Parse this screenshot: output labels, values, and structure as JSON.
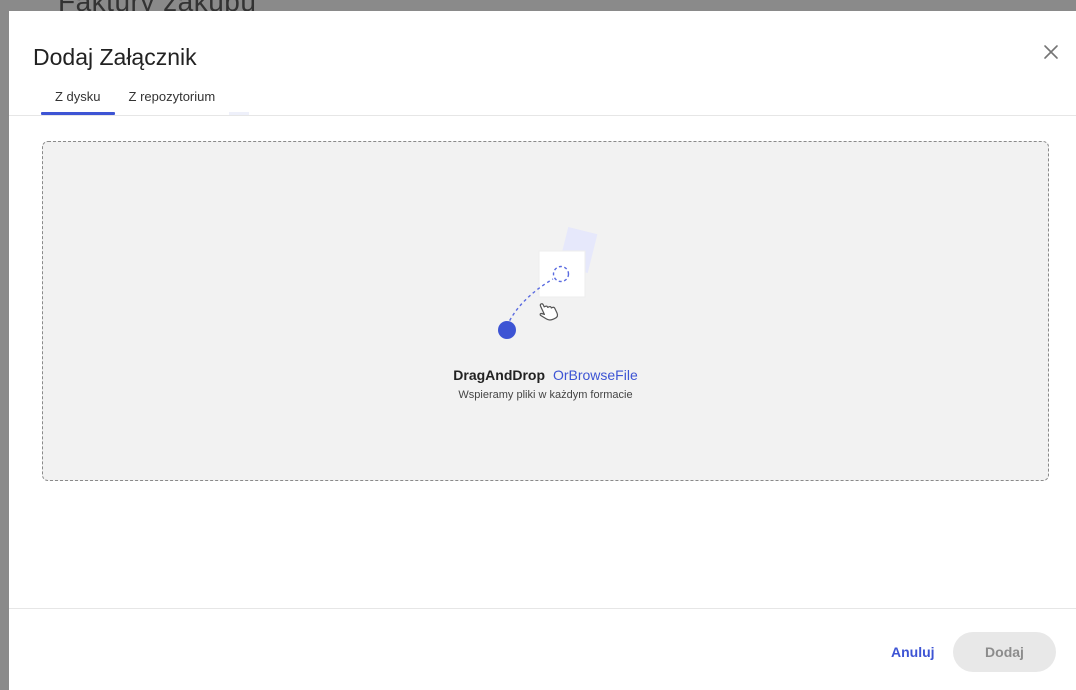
{
  "background": {
    "peek_title": "Faktury zakupu",
    "peek_right": ""
  },
  "dialog": {
    "title": "Dodaj Załącznik",
    "close_icon": "close-icon",
    "tabs": [
      {
        "label": "Z dysku",
        "active": true
      },
      {
        "label": "Z repozytorium",
        "active": false
      }
    ],
    "dropzone": {
      "main_text": "DragAndDrop",
      "browse_text": "OrBrowseFile",
      "sub_text": "Wspieramy pliki w każdym formacie",
      "illustration_icon": "drag-and-drop-illustration"
    },
    "footer": {
      "cancel_label": "Anuluj",
      "add_label": "Dodaj"
    }
  },
  "colors": {
    "accent": "#3d54d4",
    "dropzone_bg": "#f2f2f2",
    "disabled_button_bg": "#e8e8e8"
  }
}
